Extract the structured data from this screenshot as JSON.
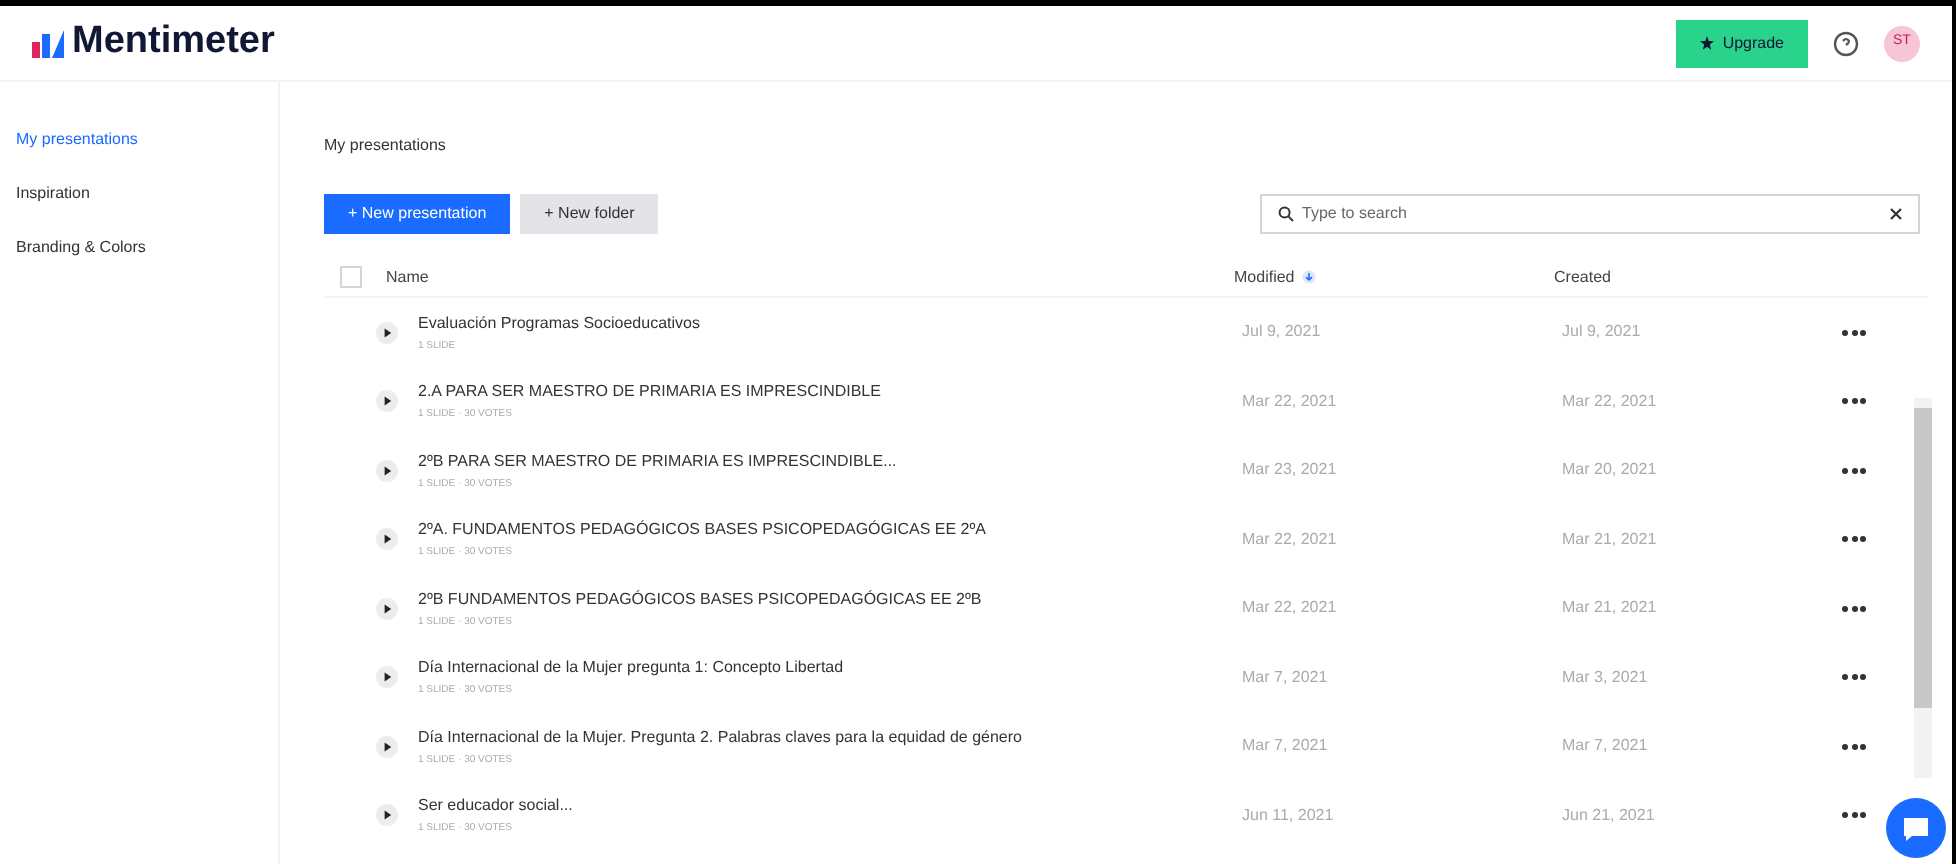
{
  "header": {
    "logo": "Mentimeter",
    "upgrade": "Upgrade",
    "avatar": "ST"
  },
  "sidebar": {
    "items": [
      {
        "label": "My presentations",
        "selected": true
      },
      {
        "label": "Inspiration",
        "selected": false
      },
      {
        "label": "Branding & Colors",
        "selected": false
      }
    ]
  },
  "page_title": "My presentations",
  "buttons": {
    "new_presentation": "+ New presentation",
    "new_folder": "+ New folder"
  },
  "search": {
    "placeholder": "Type to search"
  },
  "table": {
    "select_all_checked": false,
    "columns": [
      "Name",
      "Modified",
      "Created"
    ],
    "rows": [
      {
        "name": "Evaluación Programas Socioeducativos",
        "meta": "1 SLIDE",
        "modified": "Jul 9, 2021",
        "created": "Jul 9, 2021"
      },
      {
        "name": "2.A PARA SER MAESTRO DE PRIMARIA ES IMPRESCINDIBLE",
        "meta": "1 SLIDE · 30 VOTES",
        "modified": "Mar 22, 2021",
        "created": "Mar 22, 2021"
      },
      {
        "name": "2ºB PARA SER MAESTRO DE PRIMARIA ES IMPRESCINDIBLE...",
        "meta": "1 SLIDE · 30 VOTES",
        "modified": "Mar 23, 2021",
        "created": "Mar 20, 2021"
      },
      {
        "name": "2ºA. FUNDAMENTOS PEDAGÓGICOS BASES PSICOPEDAGÓGICAS EE 2ºA",
        "meta": "1 SLIDE · 30 VOTES",
        "modified": "Mar 22, 2021",
        "created": "Mar 21, 2021"
      },
      {
        "name": "2ºB FUNDAMENTOS PEDAGÓGICOS BASES PSICOPEDAGÓGICAS EE 2ºB",
        "meta": "1 SLIDE · 30 VOTES",
        "modified": "Mar 22, 2021",
        "created": "Mar 21, 2021"
      },
      {
        "name": "Día Internacional de la Mujer pregunta 1: Concepto Libertad",
        "meta": "1 SLIDE · 30 VOTES",
        "modified": "Mar 7, 2021",
        "created": "Mar 3, 2021"
      },
      {
        "name": "Día Internacional de la Mujer. Pregunta 2. Palabras claves para la equidad de género",
        "meta": "1 SLIDE · 30 VOTES",
        "modified": "Mar 7, 2021",
        "created": "Mar 7, 2021"
      },
      {
        "name": "Ser educador social...",
        "meta": "1 SLIDE · 30 VOTES",
        "modified": "Jun 11, 2021",
        "created": "Jun 21, 2021"
      }
    ]
  }
}
